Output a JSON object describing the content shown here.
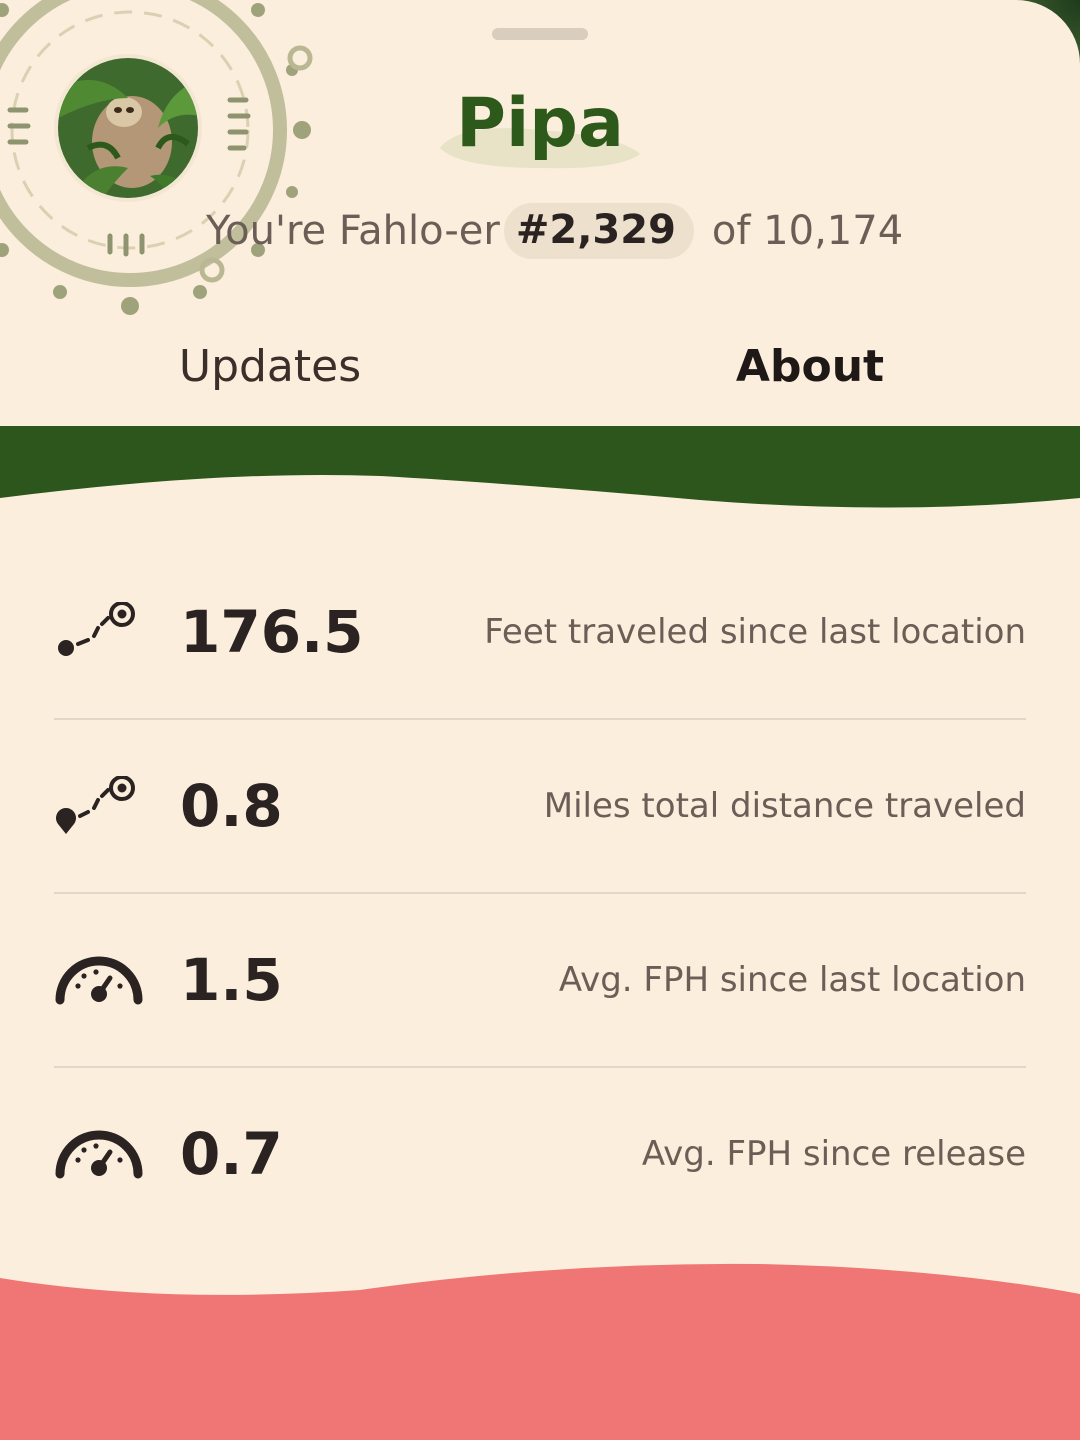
{
  "profile": {
    "name": "Pipa",
    "avatar_icon": "sloth-photo-avatar"
  },
  "rank": {
    "prefix": "You're Fahlo-er",
    "position": "#2,329",
    "suffix": "of 10,174"
  },
  "tabs": [
    {
      "label": "Updates",
      "active": false
    },
    {
      "label": "About",
      "active": true
    }
  ],
  "stats": [
    {
      "icon": "route-target-icon",
      "value": "176.5",
      "label": "Feet traveled since last location"
    },
    {
      "icon": "route-pin-target-icon",
      "value": "0.8",
      "label": "Miles total distance traveled"
    },
    {
      "icon": "speedometer-icon",
      "value": "1.5",
      "label": "Avg. FPH since last location"
    },
    {
      "icon": "speedometer-icon",
      "value": "0.7",
      "label": "Avg. FPH since release"
    }
  ],
  "colors": {
    "background": "#FCEEDD",
    "brand_green": "#2d5a1b",
    "band_green": "#2c561c",
    "band_pink": "#F07676",
    "ring": "#b9b893"
  }
}
